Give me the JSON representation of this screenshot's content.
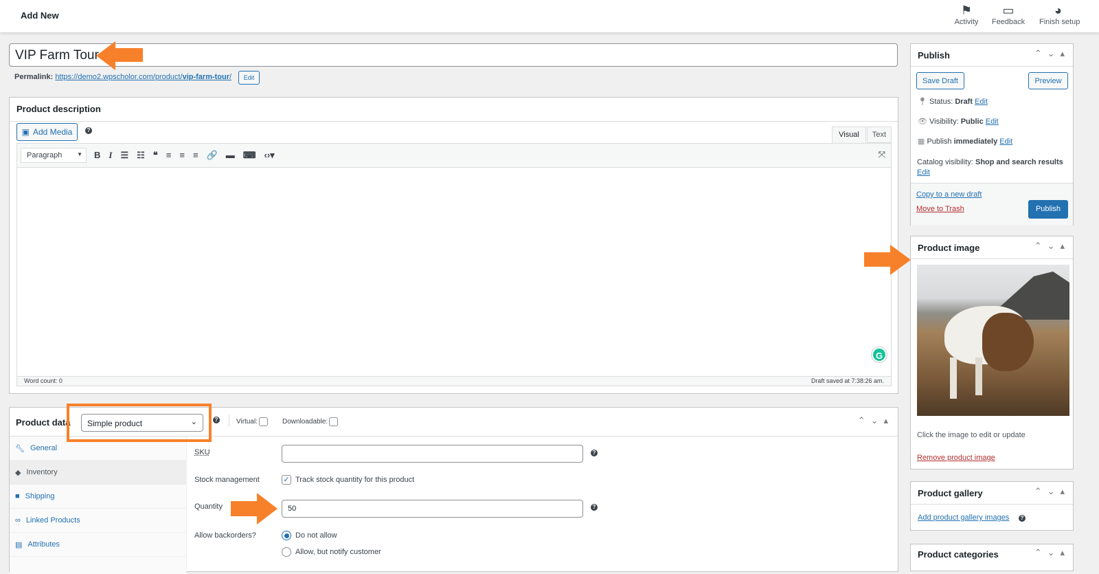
{
  "topbar": {
    "title": "Add New",
    "items": [
      {
        "label": "Activity",
        "icon": "flag-icon"
      },
      {
        "label": "Feedback",
        "icon": "feedback-icon"
      },
      {
        "label": "Finish setup",
        "icon": "progress-icon"
      }
    ]
  },
  "post": {
    "title": "VIP Farm Tour",
    "permalink_label": "Permalink:",
    "permalink_base": "https://demo2.wpscholor.com/product/",
    "permalink_slug": "vip-farm-tour",
    "permalink_end": "/",
    "edit": "Edit"
  },
  "description": {
    "title": "Product description",
    "add_media": "Add Media",
    "tab_visual": "Visual",
    "tab_text": "Text",
    "format": "Paragraph",
    "word_count": "Word count: 0",
    "draft_saved": "Draft saved at 7:38:26 am."
  },
  "product_data": {
    "title": "Product data",
    "type": "Simple product",
    "virtual": "Virtual:",
    "downloadable": "Downloadable:",
    "tabs": [
      "General",
      "Inventory",
      "Shipping",
      "Linked Products",
      "Attributes"
    ],
    "sku_label": "SKU",
    "sku_value": "",
    "stock_label": "Stock management",
    "stock_check": "Track stock quantity for this product",
    "stock_checked": true,
    "qty_label": "Quantity",
    "qty_value": "50",
    "backorders_label": "Allow backorders?",
    "backorder_options": [
      "Do not allow",
      "Allow, but notify customer"
    ],
    "backorder_selected": "Do not allow"
  },
  "publish": {
    "title": "Publish",
    "save_draft": "Save Draft",
    "preview": "Preview",
    "status_label": "Status:",
    "status": "Draft",
    "visibility_label": "Visibility:",
    "visibility": "Public",
    "publish_label": "Publish",
    "publish_when": "immediately",
    "catalog_label": "Catalog visibility:",
    "catalog": "Shop and search results",
    "edit": "Edit",
    "copy": "Copy to a new draft",
    "trash": "Move to Trash",
    "publish_btn": "Publish"
  },
  "product_image": {
    "title": "Product image",
    "hint": "Click the image to edit or update",
    "remove": "Remove product image"
  },
  "gallery": {
    "title": "Product gallery",
    "add": "Add product gallery images"
  },
  "categories": {
    "title": "Product categories"
  },
  "colors": {
    "accent": "#2271b1",
    "annotation": "#f7812a",
    "trash": "#b32d2e"
  }
}
